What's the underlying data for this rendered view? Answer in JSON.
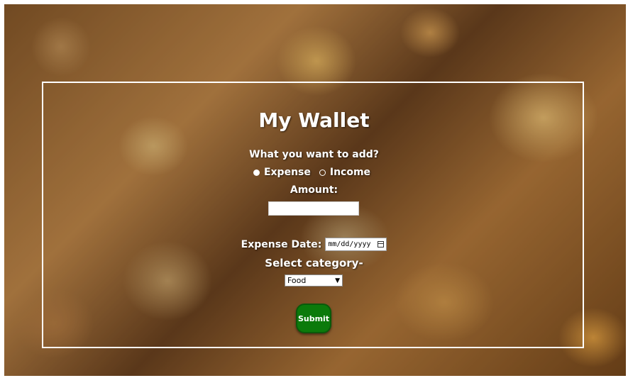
{
  "wallet": {
    "title": "My Wallet",
    "prompt": "What you want to add?",
    "type_options": [
      {
        "label": "Expense",
        "selected": true
      },
      {
        "label": "Income",
        "selected": false
      }
    ],
    "amount_label": "Amount:",
    "amount_value": "",
    "date_label": "Expense Date:",
    "date_placeholder": "mm/dd/yyyy",
    "category_label": "Select category-",
    "category_selected": "Food",
    "submit_label": "Submit"
  },
  "colors": {
    "submit_bg": "#0b7a0b",
    "text": "#ffffff"
  }
}
